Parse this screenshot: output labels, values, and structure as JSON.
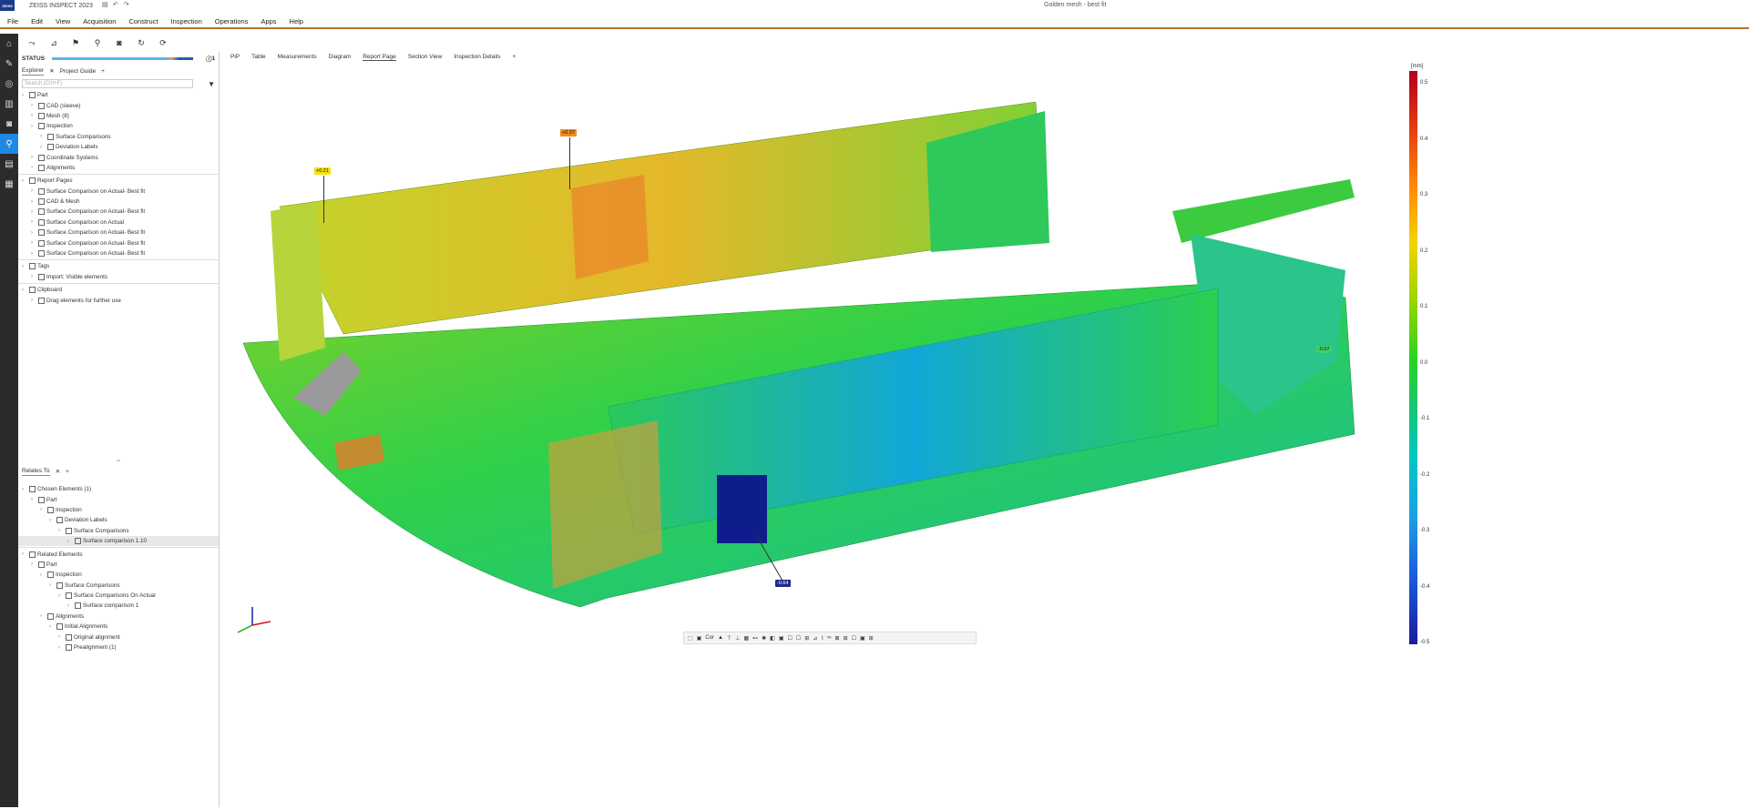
{
  "app": {
    "name": "ZEISS INSPECT 2023",
    "window_title": "Golden mesh - best fit"
  },
  "menu": [
    "File",
    "Edit",
    "View",
    "Acquisition",
    "Construct",
    "Inspection",
    "Operations",
    "Apps",
    "Help"
  ],
  "sidebar": [
    "home-icon",
    "wrench-icon",
    "measure-icon",
    "bars-icon",
    "camera-icon",
    "inspect-icon",
    "report-icon",
    "apps-icon"
  ],
  "status": {
    "label": "STATUS",
    "counter": "1"
  },
  "explorer": {
    "tabs": [
      "Explorer",
      "Project Guide"
    ],
    "search_placeholder": "Search (Ctrl+F)",
    "items": [
      {
        "label": "Part",
        "indent": 0
      },
      {
        "label": "CAD (sleeve)",
        "indent": 1
      },
      {
        "label": "Mesh (8)",
        "indent": 1
      },
      {
        "label": "Inspection",
        "indent": 1
      },
      {
        "label": "Surface Comparisons",
        "indent": 2
      },
      {
        "label": "Deviation Labels",
        "indent": 2
      },
      {
        "label": "Coordinate Systems",
        "indent": 1
      },
      {
        "label": "Alignments",
        "indent": 1
      },
      {
        "label": "Report Pages",
        "indent": 0
      },
      {
        "label": "Surface Comparison on Actual- Best fit",
        "indent": 1
      },
      {
        "label": "CAD & Mesh",
        "indent": 1
      },
      {
        "label": "Surface Comparison on Actual- Best fit",
        "indent": 1
      },
      {
        "label": "Surface Comparison on Actual",
        "indent": 1
      },
      {
        "label": "Surface Comparison on Actual- Best fit",
        "indent": 1
      },
      {
        "label": "Surface Comparison on Actual- Best fit",
        "indent": 1
      },
      {
        "label": "Surface Comparison on Actual- Best fit",
        "indent": 1
      },
      {
        "label": "Tags",
        "indent": 0
      },
      {
        "label": "Import: Visible elements",
        "indent": 1
      },
      {
        "label": "Clipboard",
        "indent": 0
      },
      {
        "label": "Drag elements for further use",
        "indent": 1
      }
    ]
  },
  "relates": {
    "tab": "Relates To",
    "items": [
      {
        "label": "Chosen Elements (1)",
        "indent": 0
      },
      {
        "label": "Part",
        "indent": 1
      },
      {
        "label": "Inspection",
        "indent": 2
      },
      {
        "label": "Deviation Labels",
        "indent": 3
      },
      {
        "label": "Surface Comparisons",
        "indent": 4
      },
      {
        "label": "Surface comparison 1.10",
        "indent": 5
      },
      {
        "label": "Related Elements",
        "indent": 0
      },
      {
        "label": "Part",
        "indent": 1
      },
      {
        "label": "Inspection",
        "indent": 2
      },
      {
        "label": "Surface Comparisons",
        "indent": 3
      },
      {
        "label": "Surface Comparisons On Actual",
        "indent": 4
      },
      {
        "label": "Surface comparison 1",
        "indent": 5
      },
      {
        "label": "Alignments",
        "indent": 2
      },
      {
        "label": "Initial Alignments",
        "indent": 3
      },
      {
        "label": "Original alignment",
        "indent": 4
      },
      {
        "label": "Prealignment (1)",
        "indent": 4
      }
    ]
  },
  "doc_tabs": [
    "PiP",
    "Table",
    "Measurements",
    "Diagram",
    "Report Page",
    "Section View",
    "Inspection Details"
  ],
  "legend": {
    "unit": "[mm]",
    "ticks": [
      "0.5",
      "0.4",
      "0.3",
      "0.2",
      "0.1",
      "0.0",
      "-0.1",
      "-0.2",
      "-0.3",
      "-0.4",
      "-0.5"
    ]
  },
  "labels": [
    {
      "text": "+0.21",
      "color": "#f3e20a"
    },
    {
      "text": "+0.37",
      "color": "#f08a1e"
    },
    {
      "text": "-0.07",
      "color": "#3ad36a"
    },
    {
      "text": "-0.64",
      "color": "#1d2a8c"
    }
  ]
}
